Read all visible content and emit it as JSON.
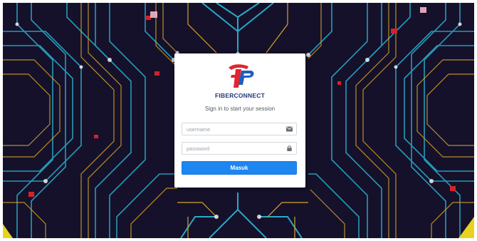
{
  "login": {
    "brand": "FIBERCONNECT",
    "subtitle": "Sign in to start your session",
    "username_placeholder": "username",
    "password_placeholder": "password",
    "submit_label": "Masuk"
  },
  "colors": {
    "accent": "#1e86f0",
    "brand_text": "#1f3a7a",
    "logo_red": "#e0262e",
    "logo_blue": "#1d5fc1"
  },
  "icons": {
    "username": "envelope-icon",
    "password": "lock-icon"
  }
}
